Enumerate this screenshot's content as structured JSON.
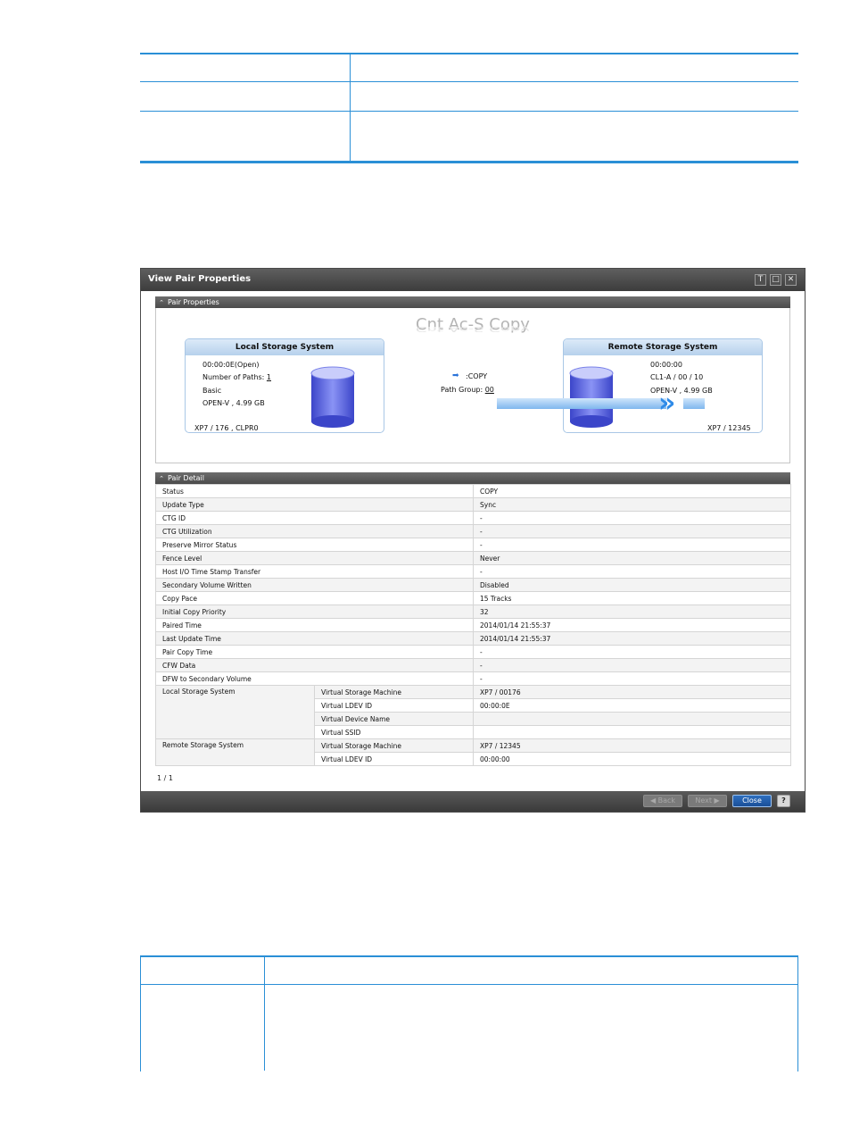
{
  "dialog": {
    "title": "View Pair Properties",
    "controls": {
      "pin": "T",
      "maximize": "□",
      "close": "✕"
    }
  },
  "pair_properties": {
    "header": "Pair Properties",
    "copy_type": "Cnt Ac-S Copy",
    "local": {
      "title": "Local Storage System",
      "ldev": "00:00:0E(Open)",
      "paths_label": "Number of Paths:",
      "paths_value": "1",
      "provisioning": "Basic",
      "emulation": "OPEN-V , 4.99 GB",
      "footer": "XP7 / 176 , CLPR0"
    },
    "remote": {
      "title": "Remote Storage System",
      "ldev": "00:00:00",
      "port": "CL1-A / 00 / 10",
      "emulation": "OPEN-V , 4.99 GB",
      "footer": "XP7 / 12345"
    },
    "link": {
      "status": ":COPY",
      "path_group_label": "Path Group:",
      "path_group_value": "00"
    }
  },
  "pair_detail": {
    "header": "Pair Detail",
    "rows": [
      {
        "label": "Status",
        "value": "COPY"
      },
      {
        "label": "Update Type",
        "value": "Sync"
      },
      {
        "label": "CTG ID",
        "value": "-"
      },
      {
        "label": "CTG Utilization",
        "value": "-"
      },
      {
        "label": "Preserve Mirror Status",
        "value": "-"
      },
      {
        "label": "Fence Level",
        "value": "Never"
      },
      {
        "label": "Host I/O Time Stamp Transfer",
        "value": "-"
      },
      {
        "label": "Secondary Volume Written",
        "value": "Disabled"
      },
      {
        "label": "Copy Pace",
        "value": "15 Tracks"
      },
      {
        "label": "Initial Copy Priority",
        "value": "32"
      },
      {
        "label": "Paired Time",
        "value": "2014/01/14 21:55:37"
      },
      {
        "label": "Last Update Time",
        "value": "2014/01/14 21:55:37"
      },
      {
        "label": "Pair Copy Time",
        "value": "-"
      },
      {
        "label": "CFW Data",
        "value": "-"
      },
      {
        "label": "DFW to Secondary Volume",
        "value": "-"
      }
    ],
    "local_group": {
      "label": "Local Storage System",
      "rows": [
        {
          "label": "Virtual Storage Machine",
          "value": "XP7 / 00176"
        },
        {
          "label": "Virtual LDEV ID",
          "value": "00:00:0E"
        },
        {
          "label": "Virtual Device Name",
          "value": ""
        },
        {
          "label": "Virtual SSID",
          "value": ""
        }
      ]
    },
    "remote_group": {
      "label": "Remote Storage System",
      "rows": [
        {
          "label": "Virtual Storage Machine",
          "value": "XP7 / 12345"
        },
        {
          "label": "Virtual LDEV ID",
          "value": "00:00:00"
        }
      ]
    },
    "pager": "1 / 1"
  },
  "footer": {
    "back": "◀ Back",
    "next": "Next ▶",
    "close": "Close",
    "help": "?"
  },
  "colors": {
    "doc_rule": "#2a8fd6",
    "accent_arrow": "#2f8be8",
    "cylinder": "#5a63e0"
  }
}
